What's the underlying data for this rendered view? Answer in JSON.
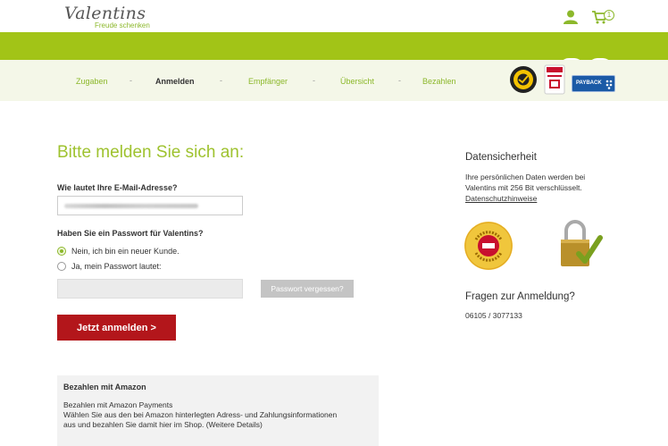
{
  "brand": {
    "name": "Valentins",
    "tagline": "Freude schenken",
    "accent": "#a2c417",
    "red": "#b3161b"
  },
  "header": {
    "user_icon": "user-icon",
    "cart_icon": "cart-icon",
    "cart_count": "1"
  },
  "steps": [
    {
      "label": "Zugaben",
      "active": false
    },
    {
      "label": "Anmelden",
      "active": true
    },
    {
      "label": "Empfänger",
      "active": false
    },
    {
      "label": "Übersicht",
      "active": false
    },
    {
      "label": "Bezahlen",
      "active": false
    }
  ],
  "step_separator": "-",
  "badges": {
    "payback": "PAYBACK"
  },
  "login": {
    "title": "Bitte melden Sie sich an:",
    "email_label": "Wie lautet Ihre E-Mail-Adresse?",
    "email_value": "",
    "password_question": "Haben Sie ein Passwort für Valentins?",
    "option_new": "Nein, ich bin ein neuer Kunde.",
    "option_password": "Ja, mein Passwort lautet:",
    "password_value": "",
    "forgot_label": "Passwort vergessen?",
    "submit_label": "Jetzt anmelden >"
  },
  "amazon": {
    "title": "Bezahlen mit Amazon",
    "line1": "Bezahlen mit Amazon Payments",
    "line2": "Wählen Sie aus den bei Amazon hinterlegten Adress- und Zahlungsinformationen",
    "line3": "aus und bezahlen Sie damit hier im Shop. (Weitere Details)"
  },
  "sidebar": {
    "security_title": "Datensicherheit",
    "security_text1": "Ihre persönlichen Daten werden bei",
    "security_text2": "Valentins mit 256 Bit verschlüsselt.",
    "privacy_link": "Datenschutzhinweise",
    "questions_title": "Fragen zur Anmeldung?",
    "phone": "06105 / 3077133"
  }
}
